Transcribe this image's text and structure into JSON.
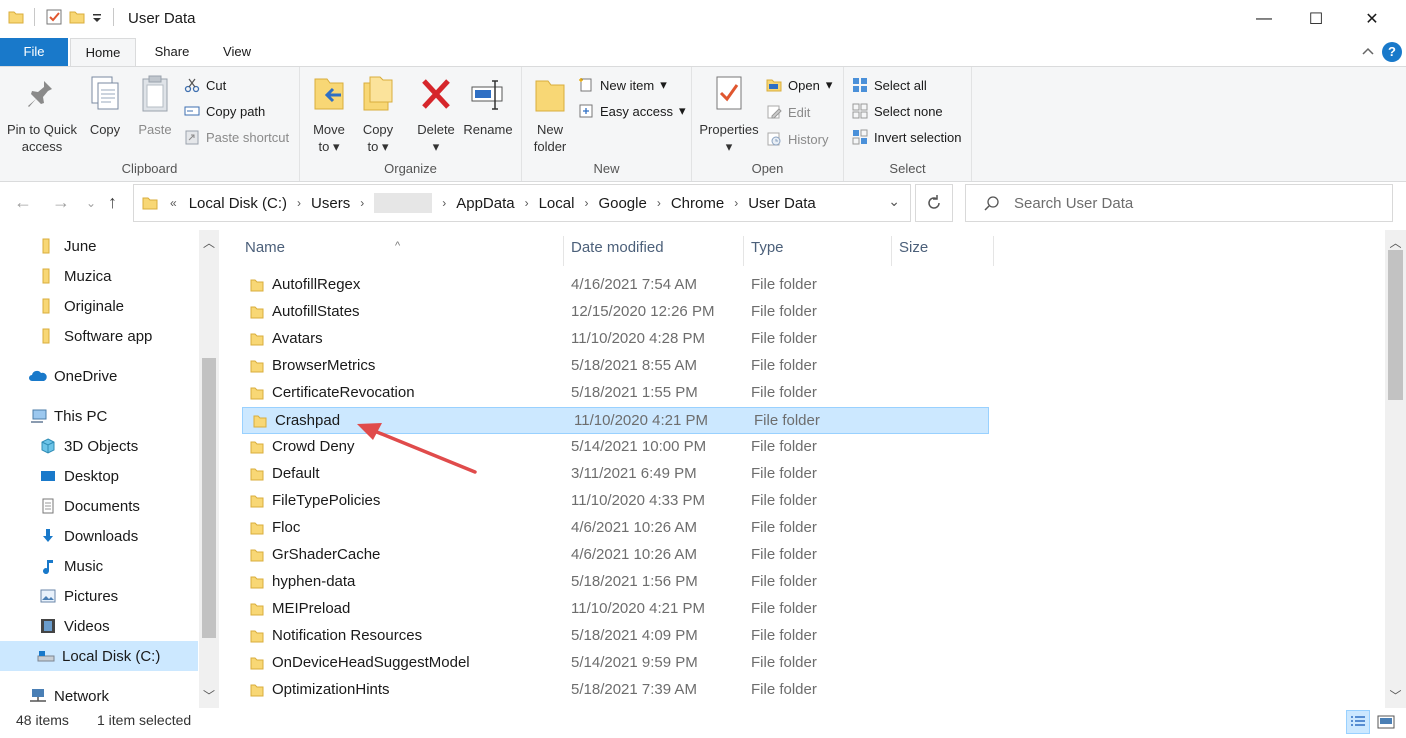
{
  "window": {
    "title": "User Data",
    "minimize": "—",
    "maximize": "☐",
    "close": "✕"
  },
  "tabs": {
    "file": "File",
    "home": "Home",
    "share": "Share",
    "view": "View",
    "help": "?"
  },
  "ribbon": {
    "clipboard": {
      "label": "Clipboard",
      "pin_line1": "Pin to Quick",
      "pin_line2": "access",
      "copy": "Copy",
      "paste": "Paste",
      "cut": "Cut",
      "copy_path": "Copy path",
      "paste_shortcut": "Paste shortcut"
    },
    "organize": {
      "label": "Organize",
      "move_line1": "Move",
      "move_line2": "to",
      "copy_line1": "Copy",
      "copy_line2": "to",
      "delete": "Delete",
      "rename": "Rename"
    },
    "new": {
      "label": "New",
      "new_folder_line1": "New",
      "new_folder_line2": "folder",
      "new_item": "New item",
      "easy_access": "Easy access"
    },
    "open": {
      "label": "Open",
      "properties": "Properties",
      "open": "Open",
      "edit": "Edit",
      "history": "History"
    },
    "select": {
      "label": "Select",
      "select_all": "Select all",
      "select_none": "Select none",
      "invert_selection": "Invert selection"
    }
  },
  "address": {
    "overflow": "«",
    "crumbs": [
      "Local Disk (C:)",
      "Users",
      "AppData",
      "Local",
      "Google",
      "Chrome",
      "User Data"
    ],
    "search_placeholder": "Search User Data"
  },
  "nav_pane": {
    "items": [
      "June",
      "Muzica",
      "Originale",
      "Software app",
      "OneDrive",
      "This PC",
      "3D Objects",
      "Desktop",
      "Documents",
      "Downloads",
      "Music",
      "Pictures",
      "Videos",
      "Local Disk (C:)",
      "Network"
    ],
    "selected": "Local Disk (C:)"
  },
  "columns": {
    "name": "Name",
    "date": "Date modified",
    "type": "Type",
    "size": "Size"
  },
  "files": [
    {
      "name": "AutofillRegex",
      "date": "4/16/2021 7:54 AM",
      "type": "File folder"
    },
    {
      "name": "AutofillStates",
      "date": "12/15/2020 12:26 PM",
      "type": "File folder"
    },
    {
      "name": "Avatars",
      "date": "11/10/2020 4:28 PM",
      "type": "File folder"
    },
    {
      "name": "BrowserMetrics",
      "date": "5/18/2021 8:55 AM",
      "type": "File folder"
    },
    {
      "name": "CertificateRevocation",
      "date": "5/18/2021 1:55 PM",
      "type": "File folder"
    },
    {
      "name": "Crashpad",
      "date": "11/10/2020 4:21 PM",
      "type": "File folder"
    },
    {
      "name": "Crowd Deny",
      "date": "5/14/2021 10:00 PM",
      "type": "File folder"
    },
    {
      "name": "Default",
      "date": "3/11/2021 6:49 PM",
      "type": "File folder"
    },
    {
      "name": "FileTypePolicies",
      "date": "11/10/2020 4:33 PM",
      "type": "File folder"
    },
    {
      "name": "Floc",
      "date": "4/6/2021 10:26 AM",
      "type": "File folder"
    },
    {
      "name": "GrShaderCache",
      "date": "4/6/2021 10:26 AM",
      "type": "File folder"
    },
    {
      "name": "hyphen-data",
      "date": "5/18/2021 1:56 PM",
      "type": "File folder"
    },
    {
      "name": "MEIPreload",
      "date": "11/10/2020 4:21 PM",
      "type": "File folder"
    },
    {
      "name": "Notification Resources",
      "date": "5/18/2021 4:09 PM",
      "type": "File folder"
    },
    {
      "name": "OnDeviceHeadSuggestModel",
      "date": "5/14/2021 9:59 PM",
      "type": "File folder"
    },
    {
      "name": "OptimizationHints",
      "date": "5/18/2021 7:39 AM",
      "type": "File folder"
    }
  ],
  "selected_file": "Crashpad",
  "status": {
    "items": "48 items",
    "selected": "1 item selected"
  },
  "colors": {
    "accent": "#1979ca",
    "selection": "#cce8ff",
    "folder": "#f8d775",
    "annotation_arrow": "#e04b4b"
  }
}
